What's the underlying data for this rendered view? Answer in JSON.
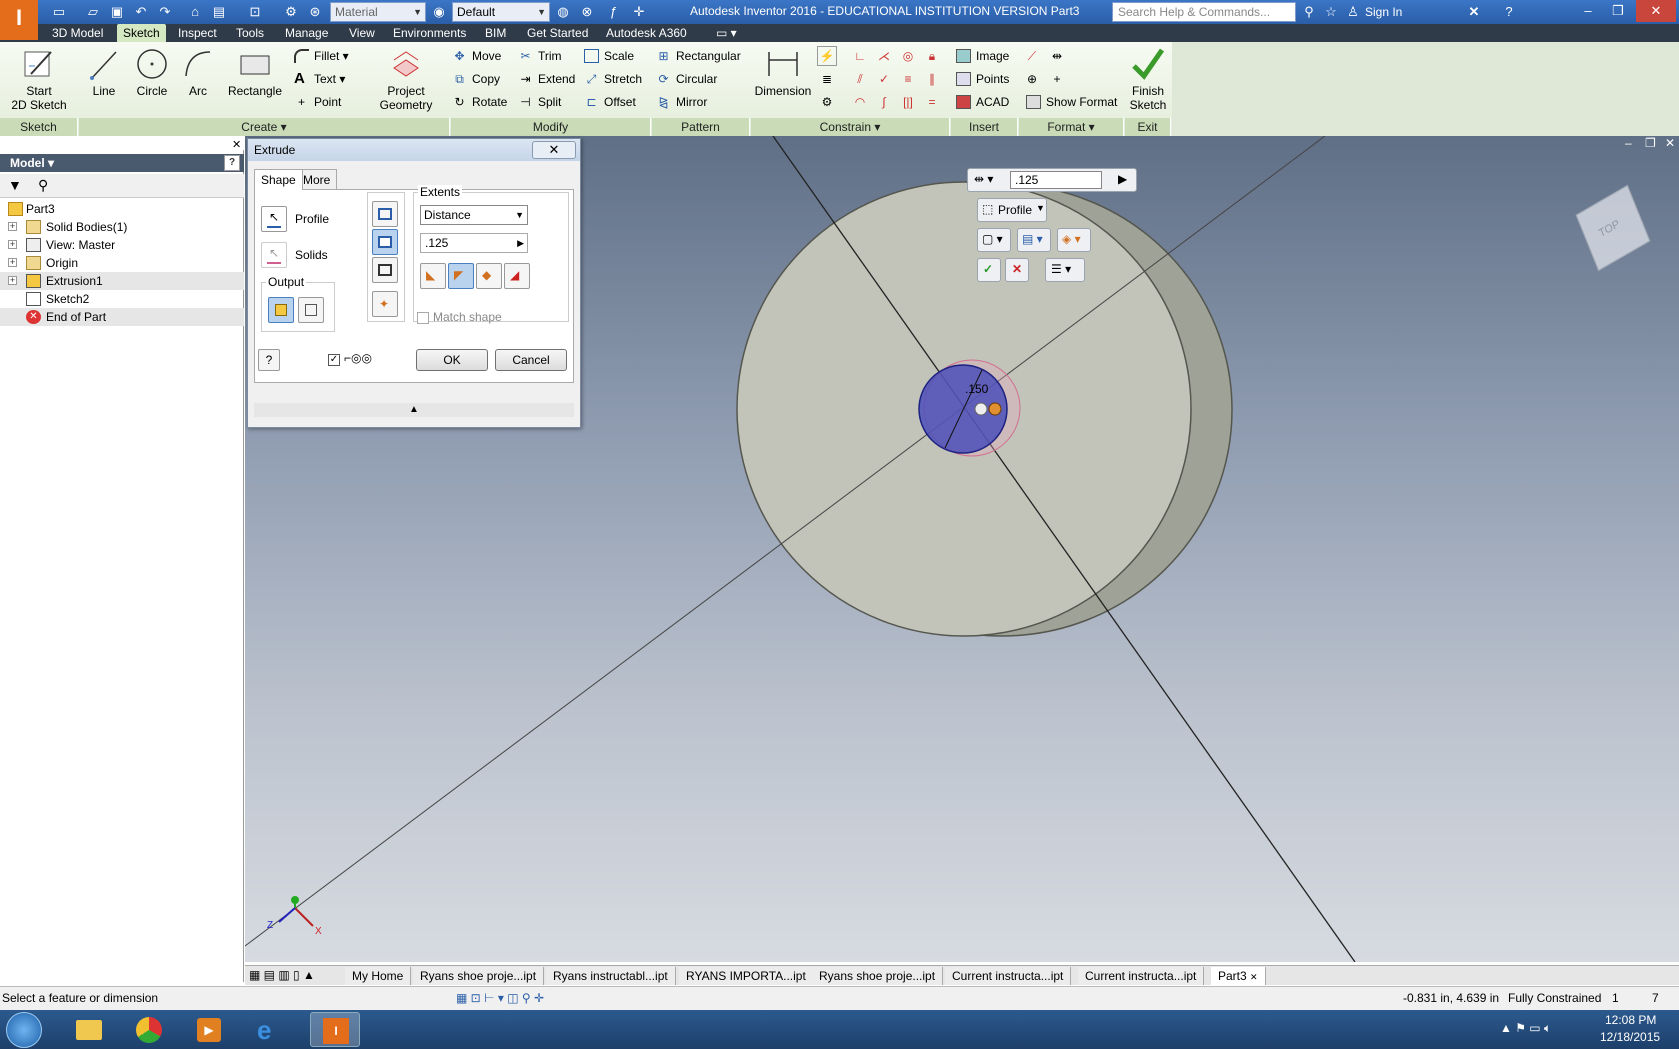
{
  "window": {
    "title": "Autodesk Inventor 2016 - EDUCATIONAL INSTITUTION VERSION   Part3",
    "material_combo": "Material",
    "appearance_combo": "Default",
    "search_placeholder": "Search Help & Commands...",
    "sign_in": "Sign In"
  },
  "menu_tabs": [
    "3D Model",
    "Sketch",
    "Inspect",
    "Tools",
    "Manage",
    "View",
    "Environments",
    "BIM",
    "Get Started",
    "Autodesk A360"
  ],
  "active_tab": "Sketch",
  "ribbon": {
    "start_sketch": "Start\n2D Sketch",
    "line": "Line",
    "circle": "Circle",
    "arc": "Arc",
    "rectangle": "Rectangle",
    "fillet": "Fillet",
    "text": "Text",
    "point": "Point",
    "project_geometry": "Project\nGeometry",
    "move": "Move",
    "copy": "Copy",
    "rotate": "Rotate",
    "trim": "Trim",
    "extend": "Extend",
    "split": "Split",
    "scale": "Scale",
    "stretch": "Stretch",
    "offset": "Offset",
    "rectangular": "Rectangular",
    "circular": "Circular",
    "mirror": "Mirror",
    "dimension": "Dimension",
    "image": "Image",
    "points": "Points",
    "acad": "ACAD",
    "show_format": "Show Format",
    "finish_sketch": "Finish\nSketch",
    "panels": {
      "sketch": "Sketch",
      "create": "Create",
      "modify": "Modify",
      "pattern": "Pattern",
      "constrain": "Constrain",
      "insert": "Insert",
      "format": "Format",
      "exit": "Exit"
    }
  },
  "browser": {
    "header": "Model",
    "items": [
      {
        "label": "Part3",
        "expandable": false
      },
      {
        "label": "Solid Bodies(1)",
        "expandable": true
      },
      {
        "label": "View: Master",
        "expandable": true
      },
      {
        "label": "Origin",
        "expandable": true
      },
      {
        "label": "Extrusion1",
        "expandable": true
      },
      {
        "label": "Sketch2",
        "expandable": false
      },
      {
        "label": "End of Part",
        "expandable": false
      }
    ]
  },
  "dialog": {
    "title": "Extrude",
    "tab_shape": "Shape",
    "tab_more": "More",
    "profile": "Profile",
    "solids": "Solids",
    "output": "Output",
    "extents": "Extents",
    "extents_type": "Distance",
    "distance": ".125",
    "match_shape": "Match shape",
    "ok": "OK",
    "cancel": "Cancel"
  },
  "mini_toolbar": {
    "distance": ".125",
    "profile": "Profile"
  },
  "viewport": {
    "dimension_label": ".150",
    "viewcube_face": "TOP",
    "axis_x": "X",
    "axis_z": "Z"
  },
  "doc_tabs": [
    "My Home",
    "Ryans shoe proje...ipt",
    "Ryans instructabl...ipt",
    "RYANS IMPORTA...ipt",
    "Ryans shoe proje...ipt",
    "Current instructa...ipt",
    "Current instructa...ipt",
    "Part3"
  ],
  "status": {
    "prompt": "Select a feature or dimension",
    "coords": "-0.831 in, 4.639 in",
    "constraint": "Fully Constrained",
    "count1": "1",
    "count2": "7"
  },
  "taskbar": {
    "time": "12:08 PM",
    "date": "12/18/2015"
  }
}
